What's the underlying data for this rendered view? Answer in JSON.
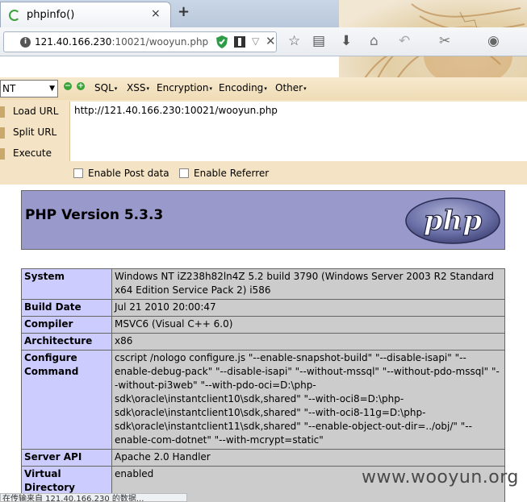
{
  "tab": {
    "title": "phpinfo()",
    "close": "×",
    "new_tab": "+"
  },
  "nav": {
    "url_gray_prefix": "",
    "url_host": "121.40.166.230",
    "url_rest": ":10021/wooyun.php",
    "info_icon": "i",
    "dropdown_icon": "▽",
    "clear_icon": "✕",
    "icons": {
      "star": "☆",
      "reader": "▤",
      "download": "⬇",
      "home": "⌂",
      "undo": "↶",
      "tools": "✂",
      "globe": "◉"
    }
  },
  "hackbar": {
    "select_value": "NT",
    "select_arrow": "▼",
    "minus": "−",
    "plus": "+",
    "menus": [
      "SQL",
      "XSS",
      "Encryption",
      "Encoding",
      "Other"
    ],
    "caret": "▾",
    "actions": {
      "load": "Load URL",
      "split": "Split URL",
      "execute": "Execute"
    },
    "url_value": "http://121.40.166.230:10021/wooyun.php",
    "checks": {
      "post": "Enable Post data",
      "referrer": "Enable Referrer"
    }
  },
  "php": {
    "version": "PHP Version 5.3.3",
    "logo_text": "php",
    "rows": [
      {
        "k": "System",
        "v": "Windows NT iZ238h82ln4Z 5.2 build 3790 (Windows Server 2003 R2 Standard x64 Edition Service Pack 2) i586"
      },
      {
        "k": "Build Date",
        "v": "Jul 21 2010 20:00:47"
      },
      {
        "k": "Compiler",
        "v": "MSVC6 (Visual C++ 6.0)"
      },
      {
        "k": "Architecture",
        "v": "x86"
      },
      {
        "k": "Configure Command",
        "v": "cscript /nologo configure.js \"--enable-snapshot-build\" \"--disable-isapi\" \"--enable-debug-pack\" \"--disable-isapi\" \"--without-mssql\" \"--without-pdo-mssql\" \"--without-pi3web\" \"--with-pdo-oci=D:\\php-sdk\\oracle\\instantclient10\\sdk,shared\" \"--with-oci8=D:\\php-sdk\\oracle\\instantclient10\\sdk,shared\" \"--with-oci8-11g=D:\\php-sdk\\oracle\\instantclient11\\sdk,shared\" \"--enable-object-out-dir=../obj/\" \"--enable-com-dotnet\" \"--with-mcrypt=static\""
      },
      {
        "k": "Server API",
        "v": "Apache 2.0 Handler"
      },
      {
        "k": "Virtual Directory Support",
        "v": "enabled"
      }
    ]
  },
  "watermark": "www.wooyun.org",
  "status": "在传输来自 121.40.166.230 的数据..."
}
